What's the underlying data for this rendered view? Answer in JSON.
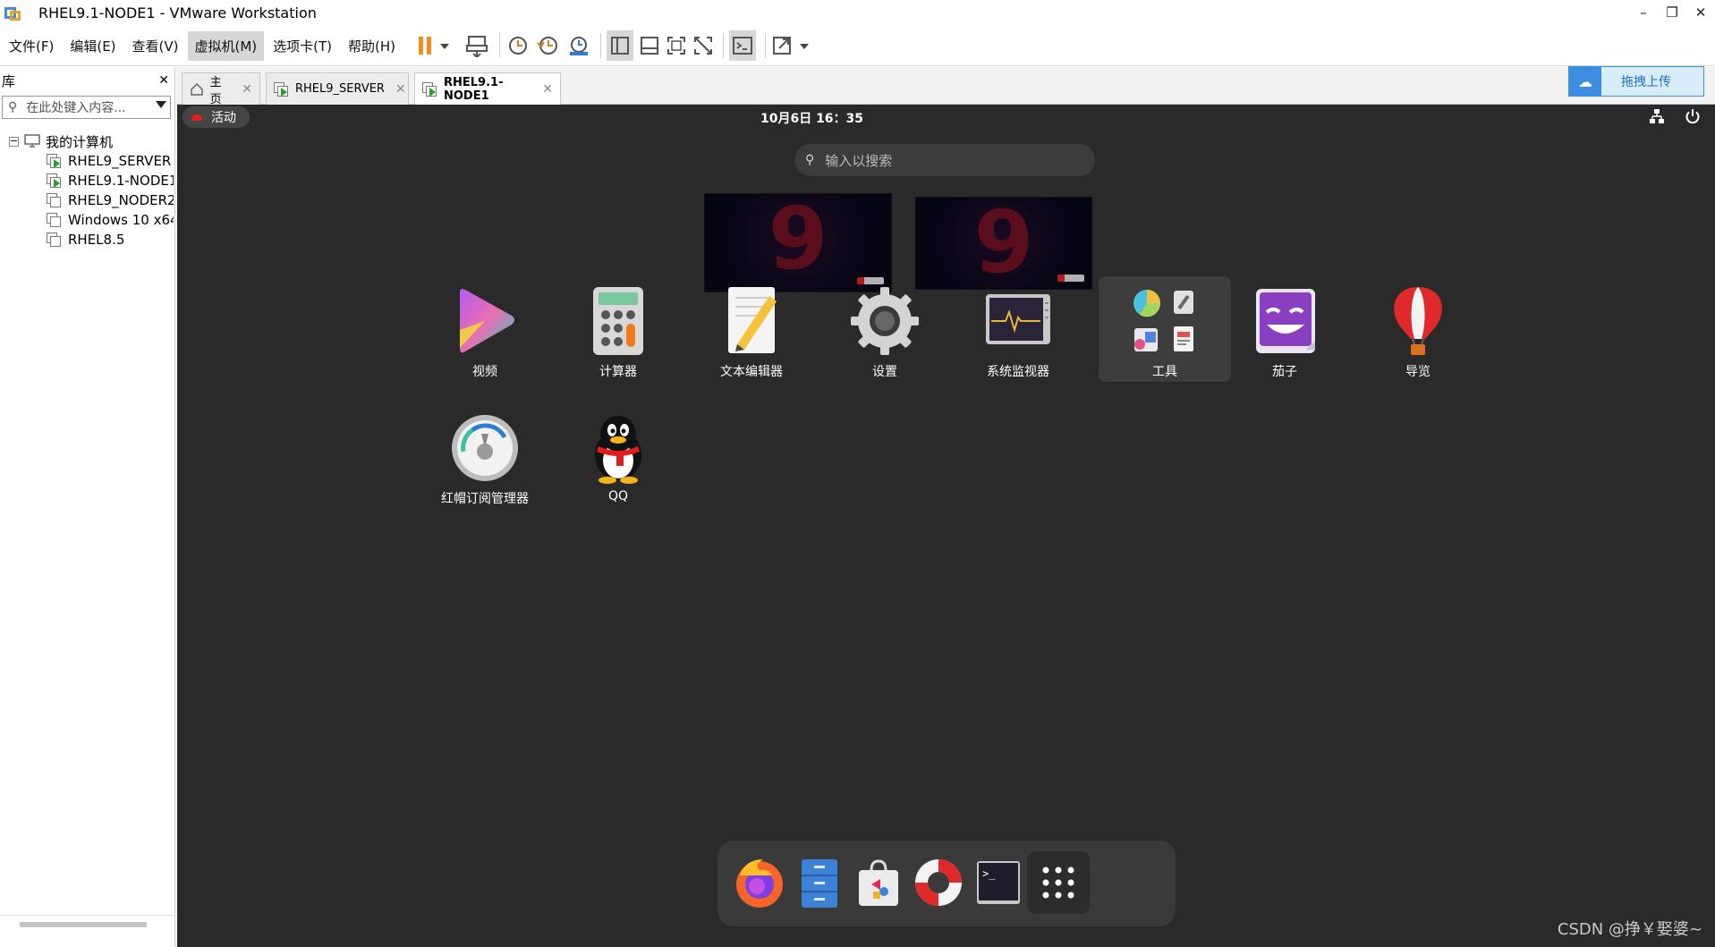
{
  "window": {
    "title": "RHEL9.1-NODE1 - VMware Workstation",
    "controls": {
      "minimize": "–",
      "restore": "❐",
      "close": "✕"
    }
  },
  "menu": {
    "file": "文件(F)",
    "edit": "编辑(E)",
    "view": "查看(V)",
    "vm": "虚拟机(M)",
    "tabs": "选项卡(T)",
    "help": "帮助(H)"
  },
  "library": {
    "title": "库",
    "close": "✕",
    "search_placeholder": "在此处键入内容...",
    "root": "我的计算机",
    "items": [
      {
        "label": "RHEL9_SERVER",
        "running": true
      },
      {
        "label": "RHEL9.1-NODE1",
        "running": true
      },
      {
        "label": "RHEL9_NODER2",
        "running": false
      },
      {
        "label": "Windows 10 x64",
        "running": false
      },
      {
        "label": "RHEL8.5",
        "running": false
      }
    ]
  },
  "tabs": [
    {
      "label": "主页",
      "close": "✕"
    },
    {
      "label": "RHEL9_SERVER",
      "close": "✕"
    },
    {
      "label": "RHEL9.1-NODE1",
      "close": "✕"
    }
  ],
  "upload_button": "拖拽上传",
  "guest": {
    "activities": "活动",
    "clock": "10月6日  16：35",
    "search_placeholder": "输入以搜索",
    "workspace_digit": "9",
    "apps": [
      {
        "label": "视频",
        "icon": "video-icon"
      },
      {
        "label": "计算器",
        "icon": "calculator-icon"
      },
      {
        "label": "文本编辑器",
        "icon": "text-editor-icon"
      },
      {
        "label": "设置",
        "icon": "settings-gear-icon"
      },
      {
        "label": "系统监视器",
        "icon": "system-monitor-icon"
      },
      {
        "label": "工具",
        "icon": "utilities-folder-icon"
      },
      {
        "label": "茄子",
        "icon": "cheese-icon"
      },
      {
        "label": "导览",
        "icon": "tour-balloon-icon"
      },
      {
        "label": "红帽订阅管理器",
        "icon": "subscription-manager-icon"
      },
      {
        "label": "QQ",
        "icon": "qq-penguin-icon"
      }
    ],
    "dock": [
      {
        "name": "firefox-icon"
      },
      {
        "name": "files-icon"
      },
      {
        "name": "software-store-icon"
      },
      {
        "name": "help-lifebuoy-icon"
      },
      {
        "name": "terminal-icon",
        "text": ">_"
      },
      {
        "name": "show-apps-grid-icon"
      }
    ]
  },
  "watermark": "CSDN @挣￥娶婆~"
}
